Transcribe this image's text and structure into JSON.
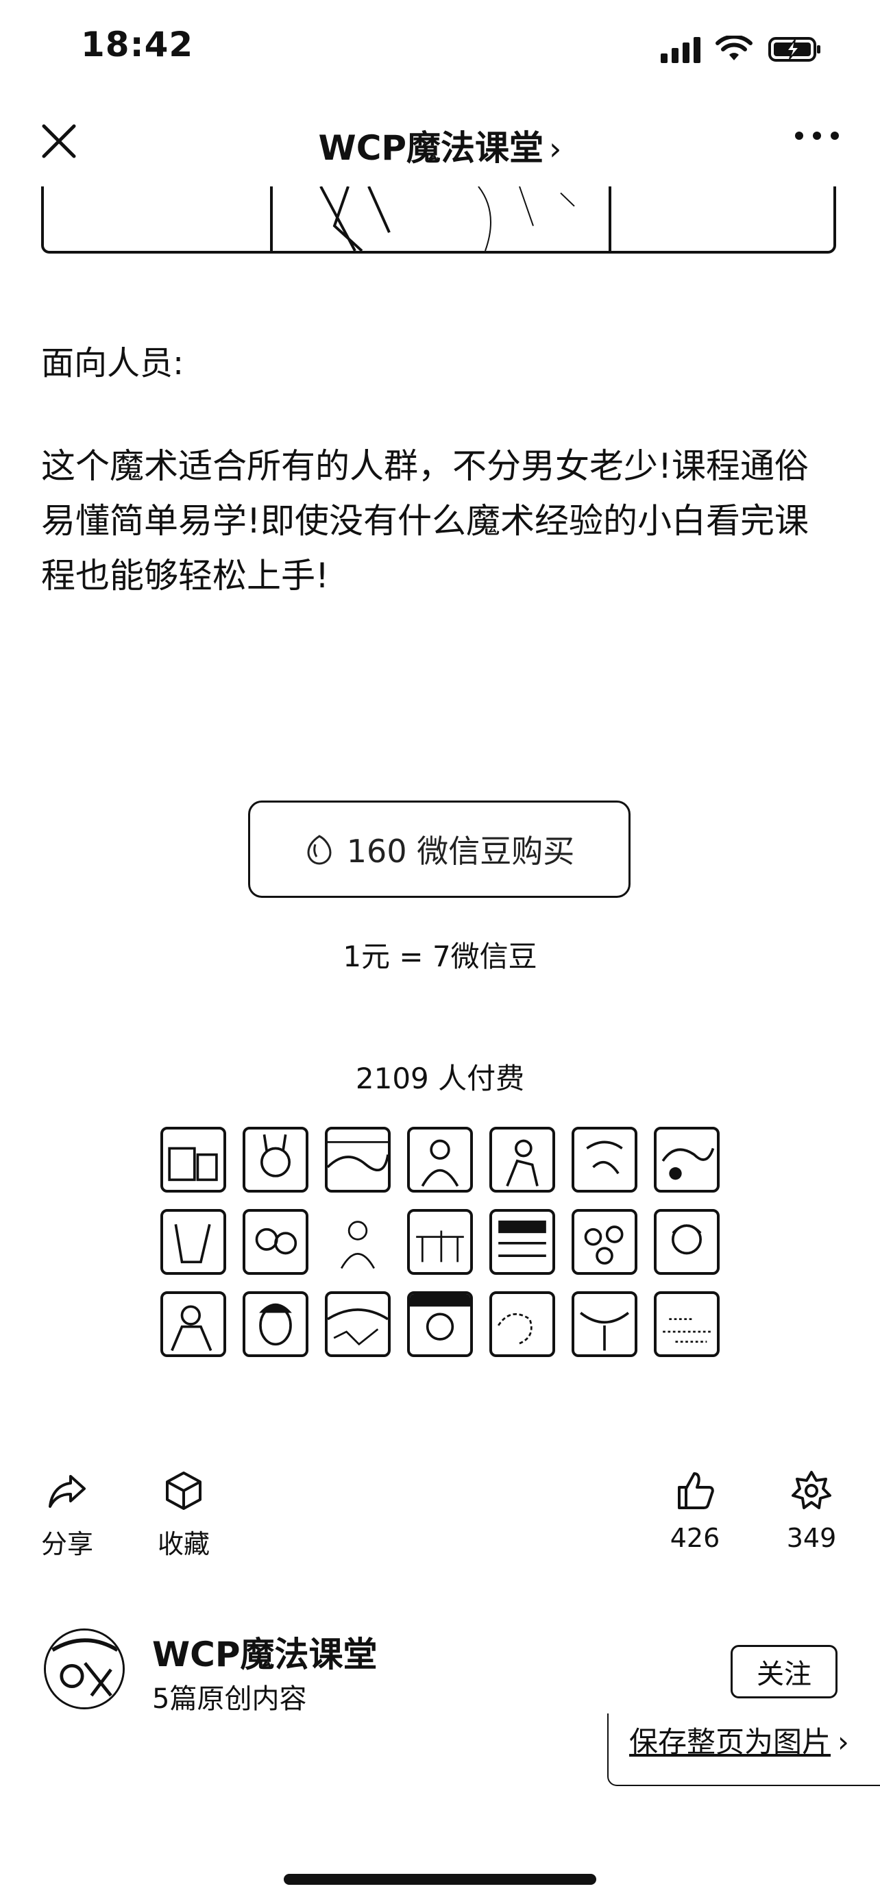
{
  "status_bar": {
    "time": "18:42"
  },
  "nav": {
    "title": "WCP魔法课堂",
    "chevron": "›"
  },
  "content": {
    "section_heading": "面向人员:",
    "description": "这个魔术适合所有的人群，不分男女老少!课程通俗易懂简单易学!即使没有什么魔术经验的小白看完课程也能够轻松上手!"
  },
  "purchase": {
    "button_label": "160 微信豆购买",
    "bean_icon": "wechat-bean-icon",
    "exchange_rate": "1元 = 7微信豆",
    "paid_count": "2109 人付费"
  },
  "actions": {
    "share_label": "分享",
    "favorite_label": "收藏",
    "like_count": "426",
    "wow_count": "349"
  },
  "account": {
    "name": "WCP魔法课堂",
    "original_count": "5篇原创内容",
    "follow_label": "关注"
  },
  "save_page": {
    "label": "保存整页为图片",
    "chevron": "›"
  }
}
